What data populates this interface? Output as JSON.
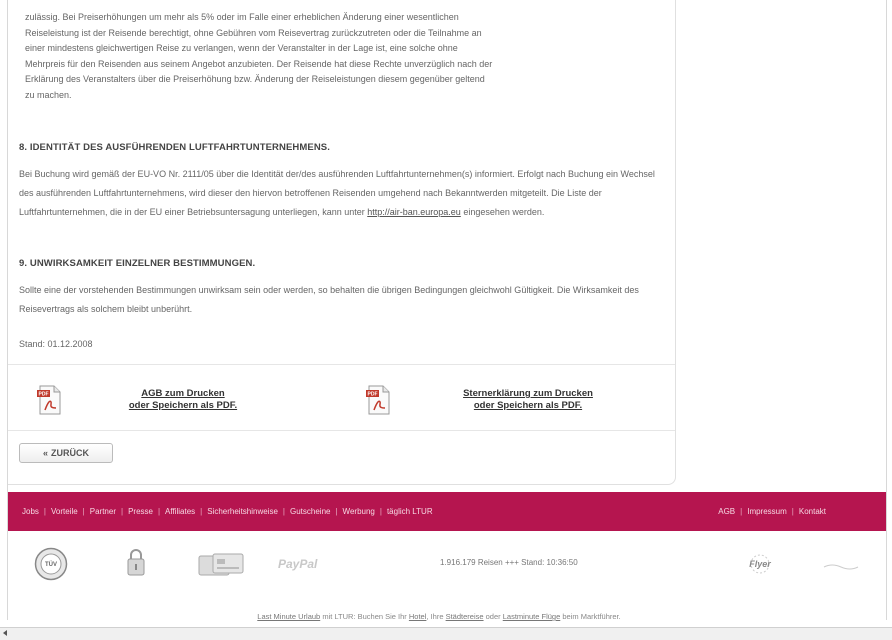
{
  "content": {
    "intro_lines": [
      "zulässig. Bei Preiserhöhungen um mehr als 5% oder im Falle einer erheblichen Änderung einer wesentlichen",
      "Reiseleistung ist der Reisende berechtigt, ohne Gebühren vom Reisevertrag zurückzutreten oder die Teilnahme an",
      "einer mindestens gleichwertigen Reise zu verlangen, wenn der Veranstalter in der Lage ist, eine solche ohne",
      "Mehrpreis für den Reisenden aus seinem Angebot anzubieten. Der Reisende hat diese Rechte unverzüglich nach der",
      "Erklärung des Veranstalters über die Preiserhöhung bzw. Änderung der Reiseleistungen diesem gegenüber geltend",
      "zu machen."
    ],
    "section8": {
      "heading": "8. IDENTITÄT DES AUSFÜHRENDEN LUFTFAHRTUNTERNEHMENS.",
      "text_before_link": "Bei Buchung wird gemäß der EU-VO Nr. 2111/05 über die Identität der/des ausführenden Luftfahrtunternehmen(s) informiert. Erfolgt nach Buchung ein Wechsel des ausführenden Luftfahrtunternehmens, wird dieser den hiervon betroffenen Reisenden umgehend nach Bekanntwerden mitgeteilt. Die Liste der Luftfahrtunternehmen, die in der EU einer Betriebsuntersagung unterliegen, kann unter ",
      "link": "http://air-ban.europa.eu",
      "text_after_link": " eingesehen werden."
    },
    "section9": {
      "heading": "9. UNWIRKSAMKEIT EINZELNER BESTIMMUNGEN.",
      "text": "Sollte eine der vorstehenden Bestimmungen unwirksam sein oder werden, so behalten die übrigen Bedingungen gleichwohl Gültigkeit. Die Wirksamkeit des Reisevertrags als solchem bleibt unberührt."
    },
    "stand": "Stand: 01.12.2008"
  },
  "downloads": {
    "agb_line1": "AGB zum Drucken",
    "agb_line2": "oder Speichern als PDF.",
    "stern_line1": "Sternerklärung zum Drucken",
    "stern_line2": "oder Speichern als PDF."
  },
  "back_button": "ZURÜCK",
  "footer": {
    "links": [
      "Jobs",
      "Vorteile",
      "Partner",
      "Presse",
      "Affiliates",
      "Sicherheitshinweise",
      "Gutscheine",
      "Werbung",
      "täglich LTUR"
    ],
    "right_links": [
      "AGB",
      "Impressum",
      "Kontakt"
    ],
    "separator": "|",
    "stats": "1.916.179 Reisen +++ Stand: 10:36:50",
    "paypal": "PayPal",
    "tuv": "TÜV",
    "flyer_logo": "Flyer"
  },
  "bottom": {
    "link1": "Last Minute Urlaub",
    "text1": " mit LTUR: Buchen Sie Ihr ",
    "link2": "Hotel",
    "text2": ", Ihre ",
    "link3": "Städtereise",
    "text3": " oder ",
    "link4": "Lastminute Flüge",
    "text4": " beim Marktführer."
  },
  "colors": {
    "footer_bg": "#b5154f",
    "pdf_red": "#c0392b"
  }
}
